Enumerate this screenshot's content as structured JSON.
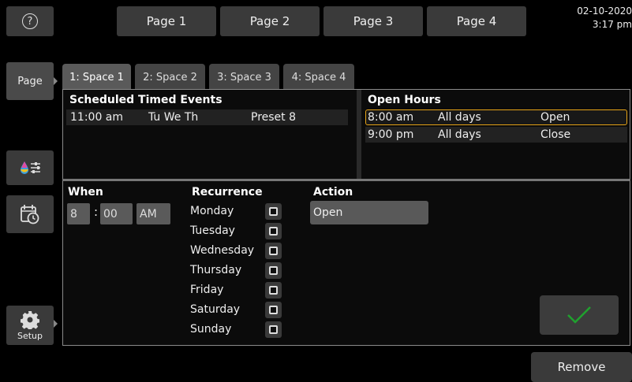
{
  "topbar": {
    "help_glyph": "?",
    "pages": [
      "Page 1",
      "Page 2",
      "Page 3",
      "Page 4"
    ],
    "date": "02-10-2020",
    "time": "3:17 pm"
  },
  "sidebar": {
    "page_label": "Page",
    "setup_label": "Setup"
  },
  "tabs": [
    "1: Space 1",
    "2: Space 2",
    "3: Space 3",
    "4: Space 4"
  ],
  "scheduled": {
    "title": "Scheduled Timed Events",
    "rows": [
      {
        "time": "11:00 am",
        "days": "Tu We Th",
        "action": "Preset 8"
      }
    ]
  },
  "open_hours": {
    "title": "Open Hours",
    "rows": [
      {
        "time": "8:00 am",
        "days": "All days",
        "action": "Open"
      },
      {
        "time": "9:00 pm",
        "days": "All days",
        "action": "Close"
      }
    ]
  },
  "editor": {
    "when_title": "When",
    "hour": "8",
    "colon": ":",
    "minute": "00",
    "ampm": "AM",
    "recurrence_title": "Recurrence",
    "days": [
      "Monday",
      "Tuesday",
      "Wednesday",
      "Thursday",
      "Friday",
      "Saturday",
      "Sunday"
    ],
    "action_title": "Action",
    "action_value": "Open"
  },
  "remove_label": "Remove",
  "colors": {
    "selection_border": "#e6a317",
    "check_green": "#1fa12e"
  }
}
